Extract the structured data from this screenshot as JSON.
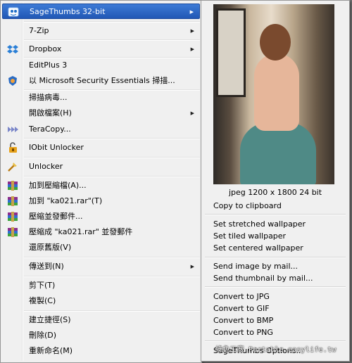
{
  "menu": {
    "items": [
      {
        "label": "SageThumbs 32-bit",
        "icon": "sagethumbs-icon",
        "submenu": true,
        "highlighted": true
      },
      {
        "label": "7-Zip",
        "icon": "",
        "submenu": true
      },
      {
        "label": "Dropbox",
        "icon": "dropbox-icon",
        "submenu": true
      },
      {
        "label": "EditPlus 3",
        "icon": "",
        "submenu": false
      },
      {
        "label": "以 Microsoft Security Essentials 掃描...",
        "icon": "security-essentials-icon",
        "submenu": false
      },
      {
        "label": "掃描病毒...",
        "icon": "",
        "submenu": false
      },
      {
        "label": "開啟檔案(H)",
        "icon": "",
        "submenu": true
      },
      {
        "label": "TeraCopy...",
        "icon": "teracopy-icon",
        "submenu": false
      },
      {
        "label": "IObit Unlocker",
        "icon": "iobit-unlocker-icon",
        "submenu": false
      },
      {
        "label": "Unlocker",
        "icon": "unlocker-icon",
        "submenu": false
      },
      {
        "label": "加到壓縮檔(A)...",
        "icon": "winrar-icon",
        "submenu": false
      },
      {
        "label": "加到 \"ka021.rar\"(T)",
        "icon": "winrar-icon",
        "submenu": false
      },
      {
        "label": "壓縮並發郵件...",
        "icon": "winrar-icon",
        "submenu": false
      },
      {
        "label": "壓縮成 \"ka021.rar\" 並發郵件",
        "icon": "winrar-icon",
        "submenu": false
      },
      {
        "label": "還原舊版(V)",
        "icon": "",
        "submenu": false
      },
      {
        "label": "傳送到(N)",
        "icon": "",
        "submenu": true
      },
      {
        "label": "剪下(T)",
        "icon": "",
        "submenu": false
      },
      {
        "label": "複製(C)",
        "icon": "",
        "submenu": false
      },
      {
        "label": "建立捷徑(S)",
        "icon": "",
        "submenu": false
      },
      {
        "label": "刪除(D)",
        "icon": "",
        "submenu": false
      },
      {
        "label": "重新命名(M)",
        "icon": "",
        "submenu": false
      }
    ],
    "arrow_glyph": "▶",
    "colors": {
      "highlight": "#2f6ac8",
      "background": "#f0f0f0"
    }
  },
  "submenu": {
    "preview_icon": "photo-preview",
    "caption": "jpeg 1200 x 1800 24 bit",
    "items": [
      {
        "label": "Copy to clipboard"
      },
      {
        "label": "Set stretched wallpaper"
      },
      {
        "label": "Set tiled wallpaper"
      },
      {
        "label": "Set centered wallpaper"
      },
      {
        "label": "Send image by mail..."
      },
      {
        "label": "Send thumbnail by mail..."
      },
      {
        "label": "Convert to JPG"
      },
      {
        "label": "Convert to GIF"
      },
      {
        "label": "Convert to BMP"
      },
      {
        "label": "Convert to PNG"
      },
      {
        "label": "SageThumbs Options..."
      }
    ]
  },
  "watermark": {
    "text": "綠色工廠 Portable.easylife.tw"
  }
}
